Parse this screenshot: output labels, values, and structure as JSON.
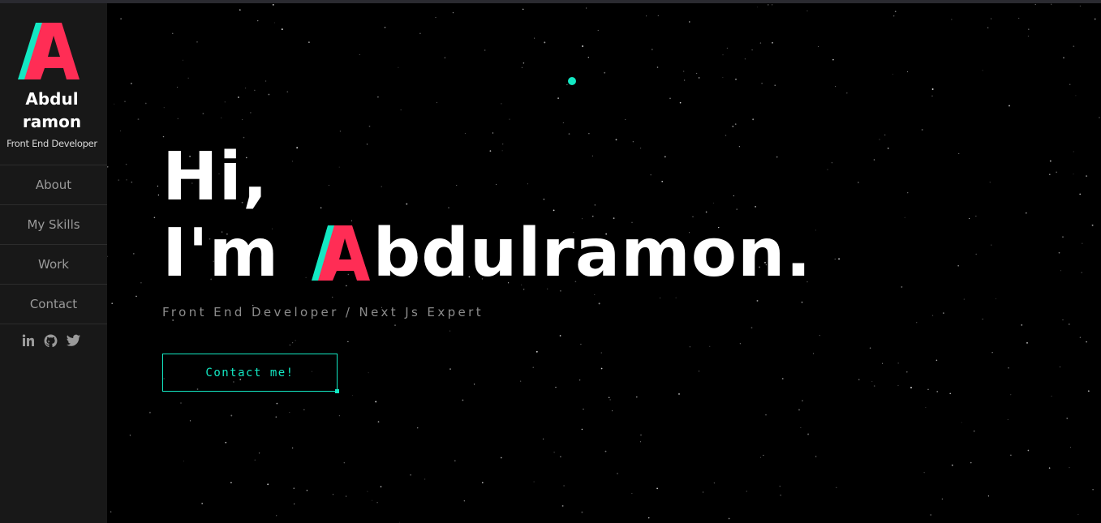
{
  "brand": {
    "name": "Abdul\nramon",
    "subtitle": "Front End Developer",
    "logo_letter": "A"
  },
  "nav": {
    "items": [
      "About",
      "My Skills",
      "Work",
      "Contact"
    ]
  },
  "socials": [
    "linkedin-icon",
    "github-icon",
    "twitter-icon"
  ],
  "hero": {
    "line1": "Hi,",
    "line2_prefix": "I'm ",
    "initial": "A",
    "line2_rest": "bdulramon.",
    "tagline": "Front End Developer / Next Js Expert"
  },
  "cta": {
    "label": "Contact me!"
  },
  "colors": {
    "accent": "#13e8c3",
    "brand_red": "#ff2d55",
    "background": "#000000",
    "sidebar": "#181818"
  }
}
